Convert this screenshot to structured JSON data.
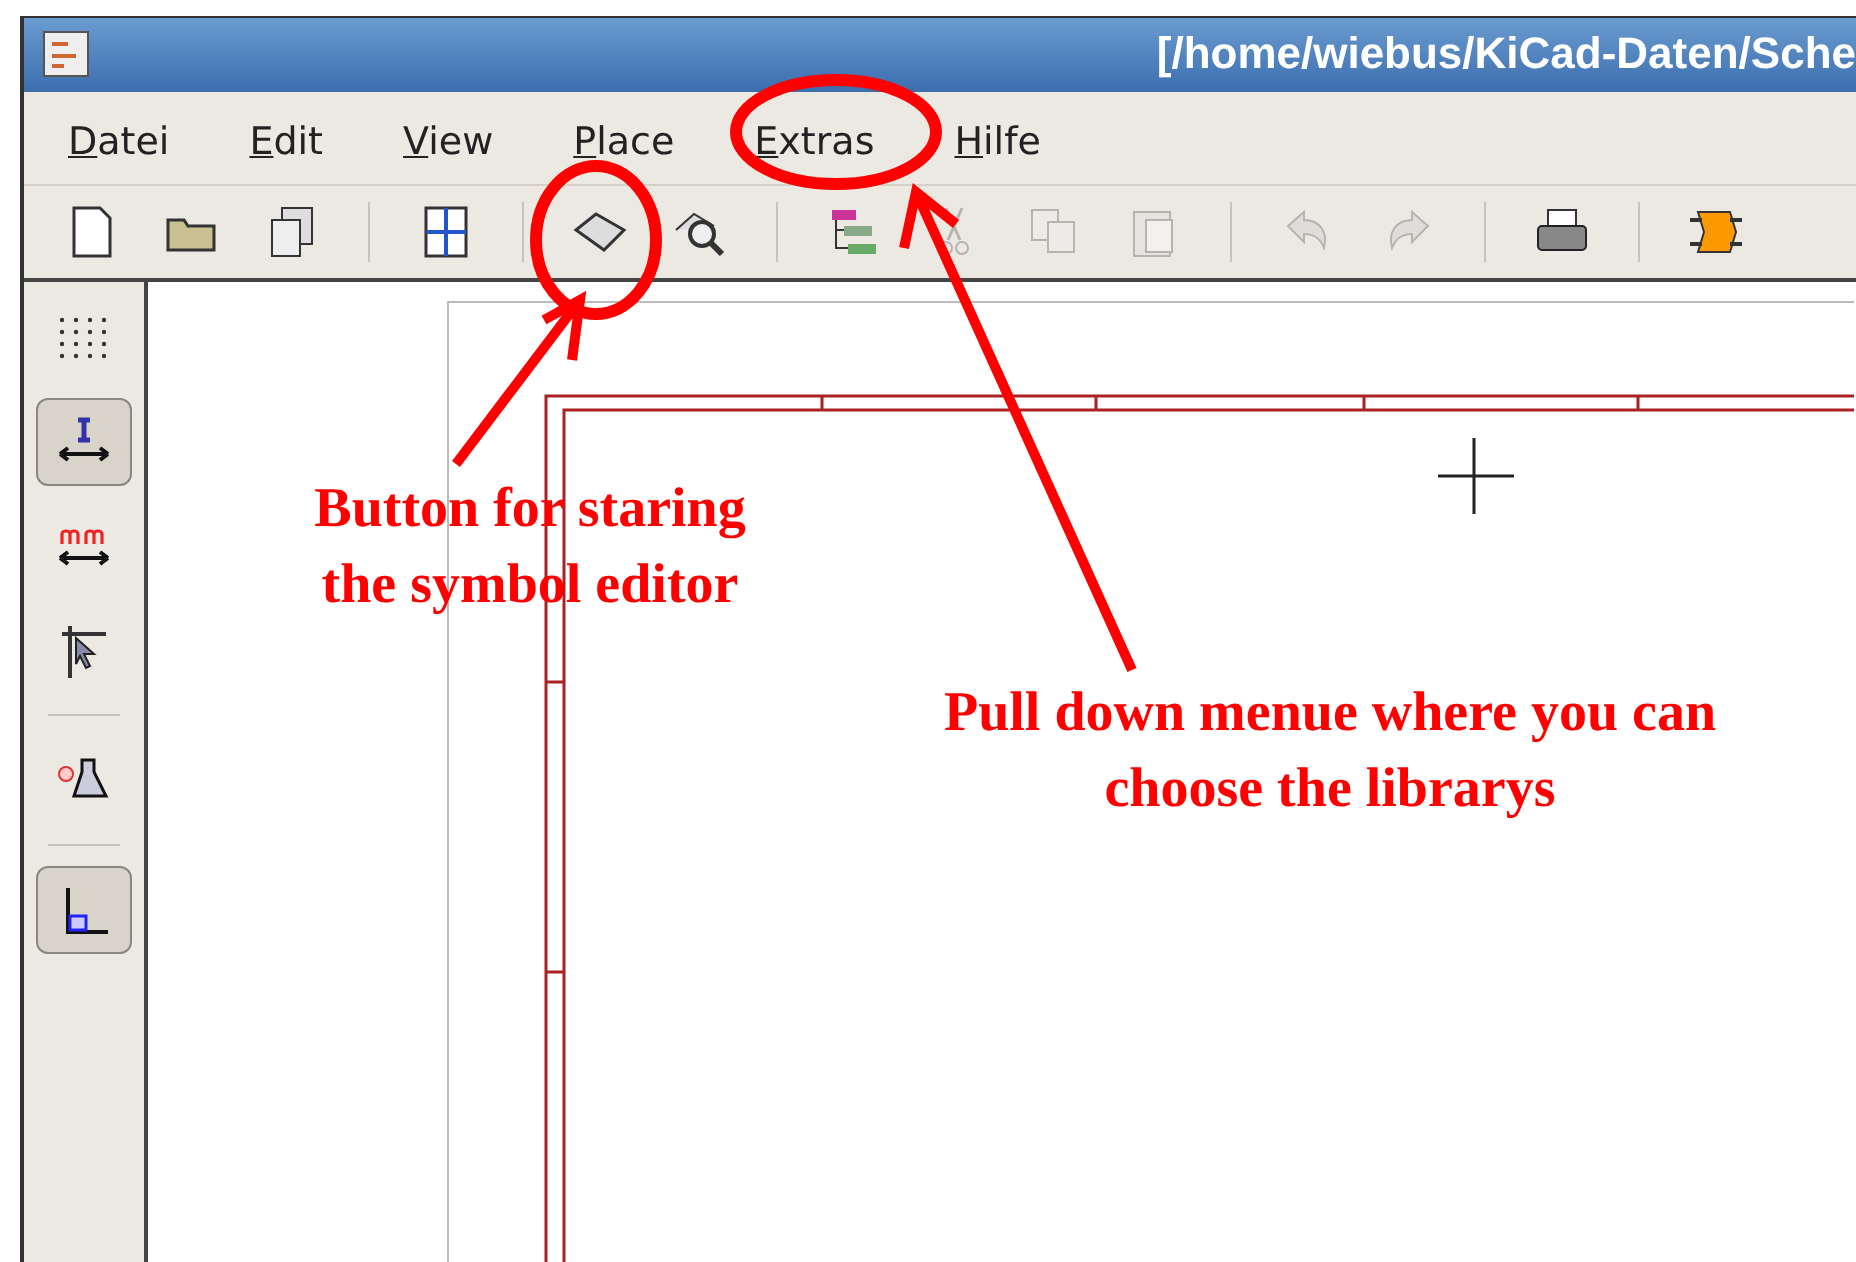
{
  "window": {
    "title": "[/home/wiebus/KiCad-Daten/Sche"
  },
  "menu": [
    {
      "label": "Datei"
    },
    {
      "label": "Edit"
    },
    {
      "label": "View"
    },
    {
      "label": "Place"
    },
    {
      "label": "Extras"
    },
    {
      "label": "Hilfe"
    }
  ],
  "toolbar": [
    {
      "kind": "new",
      "disabled": false
    },
    {
      "kind": "open",
      "disabled": false
    },
    {
      "kind": "save",
      "disabled": false
    },
    {
      "kind": "sep"
    },
    {
      "kind": "sheet",
      "disabled": false
    },
    {
      "kind": "sep"
    },
    {
      "kind": "libedit",
      "disabled": false
    },
    {
      "kind": "libview",
      "disabled": false
    },
    {
      "kind": "sep"
    },
    {
      "kind": "hierarchy",
      "disabled": false
    },
    {
      "kind": "cut",
      "disabled": true
    },
    {
      "kind": "copy",
      "disabled": true
    },
    {
      "kind": "paste",
      "disabled": true
    },
    {
      "kind": "sep"
    },
    {
      "kind": "undo",
      "disabled": true
    },
    {
      "kind": "redo",
      "disabled": true
    },
    {
      "kind": "sep"
    },
    {
      "kind": "print",
      "disabled": false
    },
    {
      "kind": "sep"
    },
    {
      "kind": "netlist",
      "disabled": false
    }
  ],
  "side_toolbar": [
    {
      "kind": "grid",
      "selected": false
    },
    {
      "kind": "units_inch",
      "selected": true
    },
    {
      "kind": "units_mm",
      "selected": false
    },
    {
      "kind": "cursor",
      "selected": false
    },
    {
      "kind": "sep"
    },
    {
      "kind": "pins",
      "selected": false
    },
    {
      "kind": "sep"
    },
    {
      "kind": "orthogonal",
      "selected": true
    }
  ],
  "annotations": [
    {
      "lines": [
        "Button for staring",
        "the symbol editor"
      ]
    },
    {
      "lines": [
        "Pull down menue where you can",
        "choose the librarys"
      ]
    }
  ]
}
